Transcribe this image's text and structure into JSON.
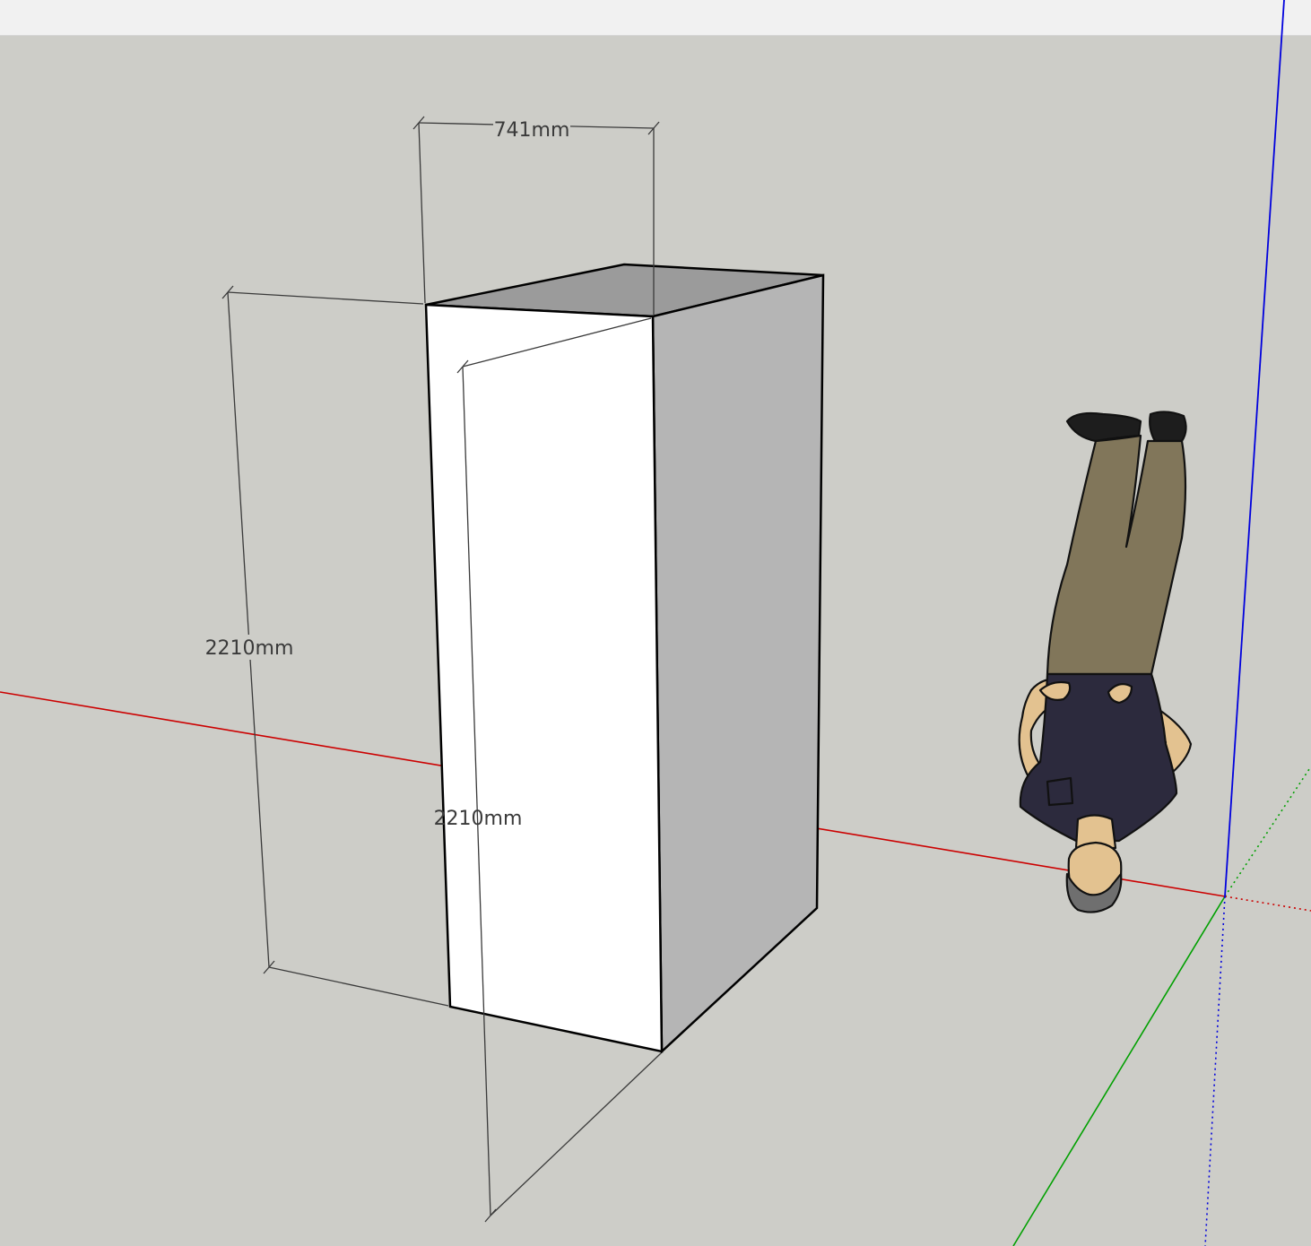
{
  "colors": {
    "background": "#cdcdc8",
    "toolbar": "#f1f1f1",
    "axis_red": "#cc0000",
    "axis_green": "#00a000",
    "axis_blue": "#0000dd",
    "face_front": "#ffffff",
    "face_right": "#b5b5b5",
    "face_top": "#9b9b9b",
    "dimension_line": "#3a3a3a",
    "figure_shirt": "#2c2a3d",
    "figure_pants": "#81765a",
    "figure_skin": "#e3c290",
    "figure_hair": "#6f6f6f"
  },
  "dimensions": {
    "width_label": "741mm",
    "height_label_left": "2210mm",
    "height_label_inner": "2210mm"
  }
}
